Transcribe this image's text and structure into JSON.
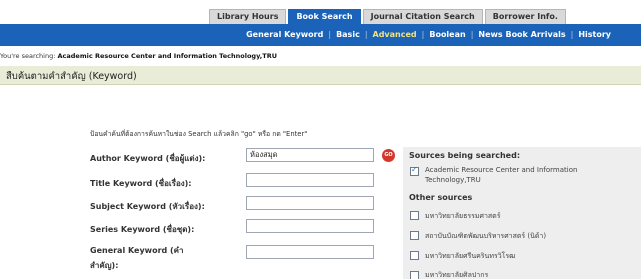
{
  "top_tabs": [
    {
      "label": "Library Hours",
      "active": false
    },
    {
      "label": "Book Search",
      "active": true
    },
    {
      "label": "Journal Citation Search",
      "active": false
    },
    {
      "label": "Borrower Info.",
      "active": false
    }
  ],
  "sub_nav": [
    {
      "label": "General Keyword",
      "active": false
    },
    {
      "label": "Basic",
      "active": false
    },
    {
      "label": "Advanced",
      "active": true
    },
    {
      "label": "Boolean",
      "active": false
    },
    {
      "label": "News Book Arrivals",
      "active": false
    },
    {
      "label": "History",
      "active": false
    }
  ],
  "searching": {
    "prefix": "You're searching:",
    "library": "Academic Resource Center and Information Technology,TRU"
  },
  "section_title": "สืบค้นตามคำสำคัญ (Keyword)",
  "instruction": "ป้อนคำค้นที่ต้องการค้นหาในช่อง Search แล้วคลิก \"go\" หรือ กด \"Enter\"",
  "form": {
    "fields": [
      {
        "label": "Author Keyword (ชื่อผู้แต่ง):",
        "value": "ห้องสมุด"
      },
      {
        "label": "Title Keyword (ชื่อเรื่อง):",
        "value": ""
      },
      {
        "label": "Subject Keyword (หัวเรื่อง):",
        "value": ""
      },
      {
        "label": "Series Keyword (ชื่อชุด):",
        "value": ""
      }
    ],
    "general_label_line1": "General Keyword (คำ",
    "general_label_line2": "สำคัญ):",
    "general_value": "",
    "go_label": "GO"
  },
  "sources": {
    "title": "Sources being searched:",
    "selected_line1": "Academic Resource Center and Information",
    "selected_line2": "Technology,TRU",
    "other_title": "Other sources",
    "others": [
      "มหาวิทยาลัยธรรมศาสตร์",
      "สถาบันบัณฑิตพัฒนบริหารศาสตร์ (นิด้า)",
      "มหาวิทยาลัยศรีนครินทรวิโรฒ",
      "มหาวิทยาลัยศิลปากร"
    ]
  },
  "colors": {
    "nav_blue": "#1b63b8",
    "active_sub_nav": "#f6e27a",
    "section_band": "#e9ecd7",
    "go_red": "#d4372b"
  }
}
